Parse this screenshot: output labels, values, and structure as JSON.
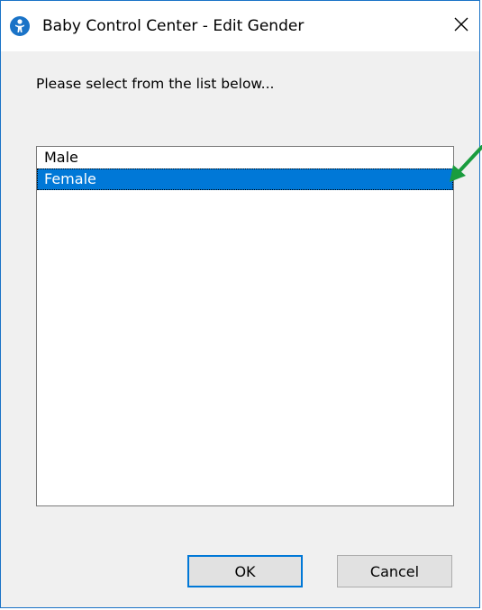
{
  "window": {
    "title": "Baby Control Center - Edit Gender",
    "close_glyph": "✕",
    "accent_color": "#0078d7",
    "frame_color": "#1a73c7"
  },
  "icons": {
    "app": "baby-app-icon",
    "close": "close-icon",
    "annotation": "green-arrow-icon"
  },
  "dialog": {
    "prompt": "Please select from the list below...",
    "options": [
      {
        "label": "Male",
        "selected": false
      },
      {
        "label": "Female",
        "selected": true
      }
    ],
    "ok_label": "OK",
    "cancel_label": "Cancel"
  },
  "annotation": {
    "color": "#1a9c3e"
  }
}
